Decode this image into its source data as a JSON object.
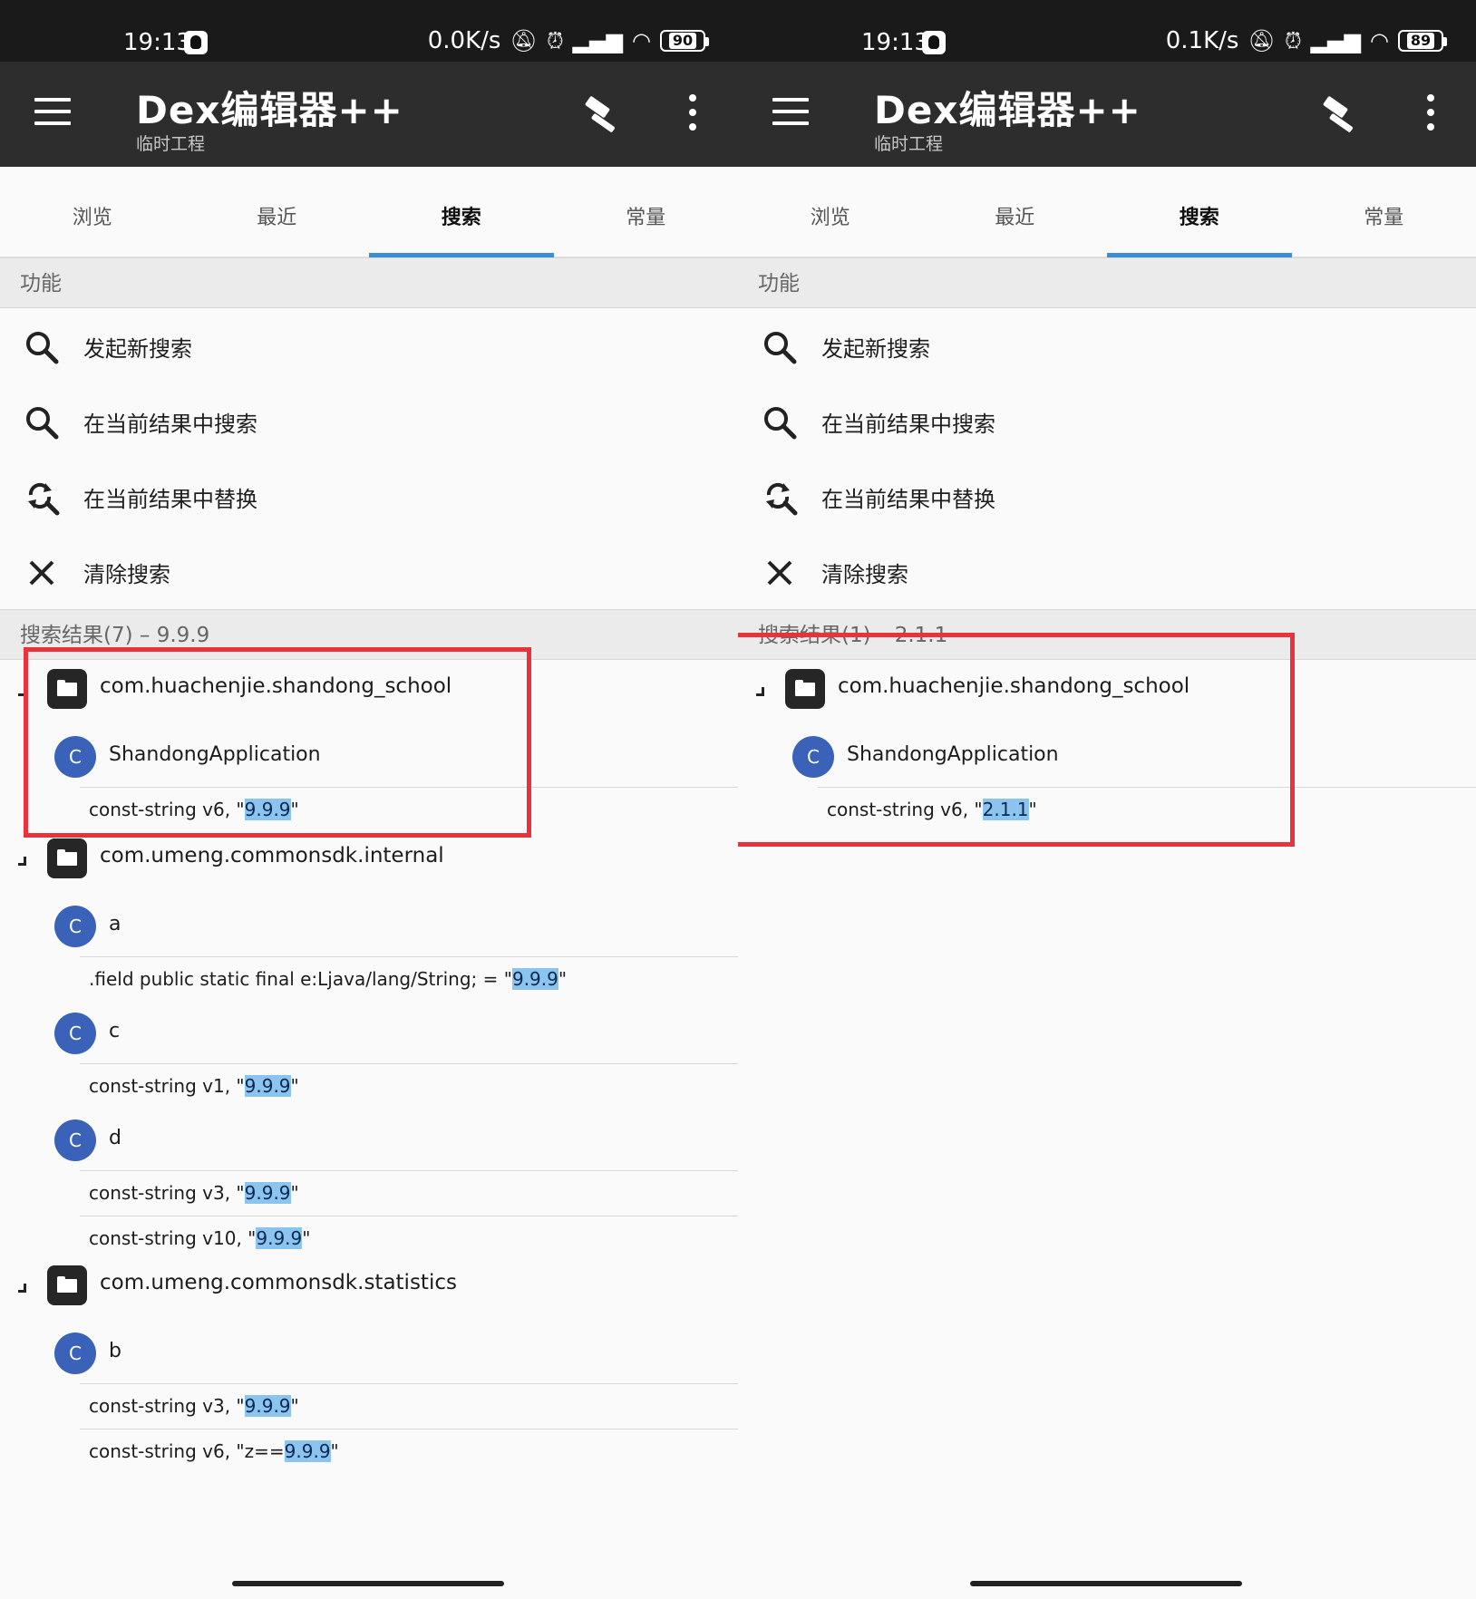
{
  "left": {
    "status": {
      "time": "19:13",
      "speed": "0.0K/s",
      "battery": "90"
    },
    "appbar": {
      "title": "Dex编辑器++",
      "subtitle": "临时工程"
    },
    "tabs": [
      "浏览",
      "最近",
      "搜索",
      "常量"
    ],
    "functions_header": "功能",
    "functions": [
      "发起新搜索",
      "在当前结果中搜索",
      "在当前结果中替换",
      "清除搜索"
    ],
    "results_header": "搜索结果(7) – 9.9.9",
    "packages": [
      {
        "name": "com.huachenjie.shandong_school",
        "classes": [
          {
            "badge": "C",
            "name": "ShandongApplication",
            "results": [
              {
                "pre": "const-string v6, \"",
                "hl": "9.9.9",
                "post": "\""
              }
            ]
          }
        ]
      },
      {
        "name": "com.umeng.commonsdk.internal",
        "classes": [
          {
            "badge": "C",
            "name": "a",
            "results": [
              {
                "pre": ".field public static final e:Ljava/lang/String; = \"",
                "hl": "9.9.9",
                "post": "\""
              }
            ]
          },
          {
            "badge": "C",
            "name": "c",
            "results": [
              {
                "pre": "const-string v1, \"",
                "hl": "9.9.9",
                "post": "\""
              }
            ]
          },
          {
            "badge": "C",
            "name": "d",
            "results": [
              {
                "pre": "const-string v3, \"",
                "hl": "9.9.9",
                "post": "\""
              },
              {
                "pre": "const-string v10, \"",
                "hl": "9.9.9",
                "post": "\""
              }
            ]
          }
        ]
      },
      {
        "name": "com.umeng.commonsdk.statistics",
        "classes": [
          {
            "badge": "C",
            "name": "b",
            "results": [
              {
                "pre": "const-string v3, \"",
                "hl": "9.9.9",
                "post": "\""
              },
              {
                "pre": "const-string v6, \"z==",
                "hl": "9.9.9",
                "post": "\""
              }
            ]
          }
        ]
      }
    ]
  },
  "right": {
    "status": {
      "time": "19:13",
      "speed": "0.1K/s",
      "battery": "89"
    },
    "appbar": {
      "title": "Dex编辑器++",
      "subtitle": "临时工程"
    },
    "tabs": [
      "浏览",
      "最近",
      "搜索",
      "常量"
    ],
    "functions_header": "功能",
    "functions": [
      "发起新搜索",
      "在当前结果中搜索",
      "在当前结果中替换",
      "清除搜索"
    ],
    "results_header": "搜索结果(1) – 2.1.1",
    "packages": [
      {
        "name": "com.huachenjie.shandong_school",
        "classes": [
          {
            "badge": "C",
            "name": "ShandongApplication",
            "results": [
              {
                "pre": "const-string v6, \"",
                "hl": "2.1.1",
                "post": "\""
              }
            ]
          }
        ]
      }
    ]
  },
  "colors": {
    "accent": "#3c8dd8",
    "highlight": "#8cc4f0",
    "annotation_red": "#e8333c",
    "class_badge": "#3a62b8"
  }
}
